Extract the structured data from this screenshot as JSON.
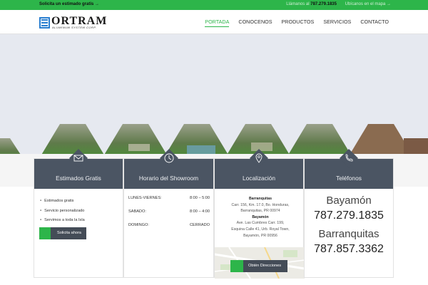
{
  "topbar": {
    "estimate_label": "Solicita un estimado gratis",
    "estimate_arrow": "→",
    "call_label": "Llámanos al",
    "phone": "787.279.1835",
    "map_link": "Ubícanos en el mapa →"
  },
  "brand": {
    "name": "ORTRAM",
    "tagline": "ALUMINUM SYSTEM CORP."
  },
  "nav": {
    "items": [
      {
        "label": "PORTADA"
      },
      {
        "label": "CONOCENOS"
      },
      {
        "label": "PRODUCTOS"
      },
      {
        "label": "SERVICIOS"
      },
      {
        "label": "CONTACTO"
      }
    ]
  },
  "cards": {
    "estimates": {
      "title": "Estimados Gratis",
      "icon": "envelope-icon",
      "bullets": [
        "Estimados gratis",
        "Servicio personalizado",
        "Servimos a toda la Isla"
      ],
      "button": "Solicita ahora"
    },
    "showroom": {
      "title": "Horario del Showroom",
      "icon": "clock-icon",
      "rows": [
        {
          "day": "LUNES-VIERNES:",
          "hours": "8:00 – 5:00"
        },
        {
          "day": "SABADO:",
          "hours": "8:00 – 4:00"
        },
        {
          "day": "DOMINGO:",
          "hours": "CERRADO"
        }
      ]
    },
    "location": {
      "title": "Localización",
      "icon": "map-pin-icon",
      "place1": "Barranquitas",
      "addr1_line1": "Carr. 156, Km. 17.0, Bo. Honduras,",
      "addr1_line2": "Barranquitas, PR 00974",
      "place2": "Bayamón",
      "addr2_line1": "Ave. Las Cumbres Carr. 199,",
      "addr2_line2": "Esquina Calle 41, Urb. Royal Town,",
      "addr2_line3": "Bayamón, PR 00956",
      "button": "Obtén Direcciones"
    },
    "phones": {
      "title": "Teléfonos",
      "icon": "phone-icon",
      "city1": "Bayamón",
      "phone1": "787.279.1835",
      "city2": "Barranquitas",
      "phone2": "787.857.3362"
    }
  },
  "colors": {
    "accent": "#2db54a",
    "card_header": "#4b5563",
    "hero_bg": "#e6e9f0"
  }
}
